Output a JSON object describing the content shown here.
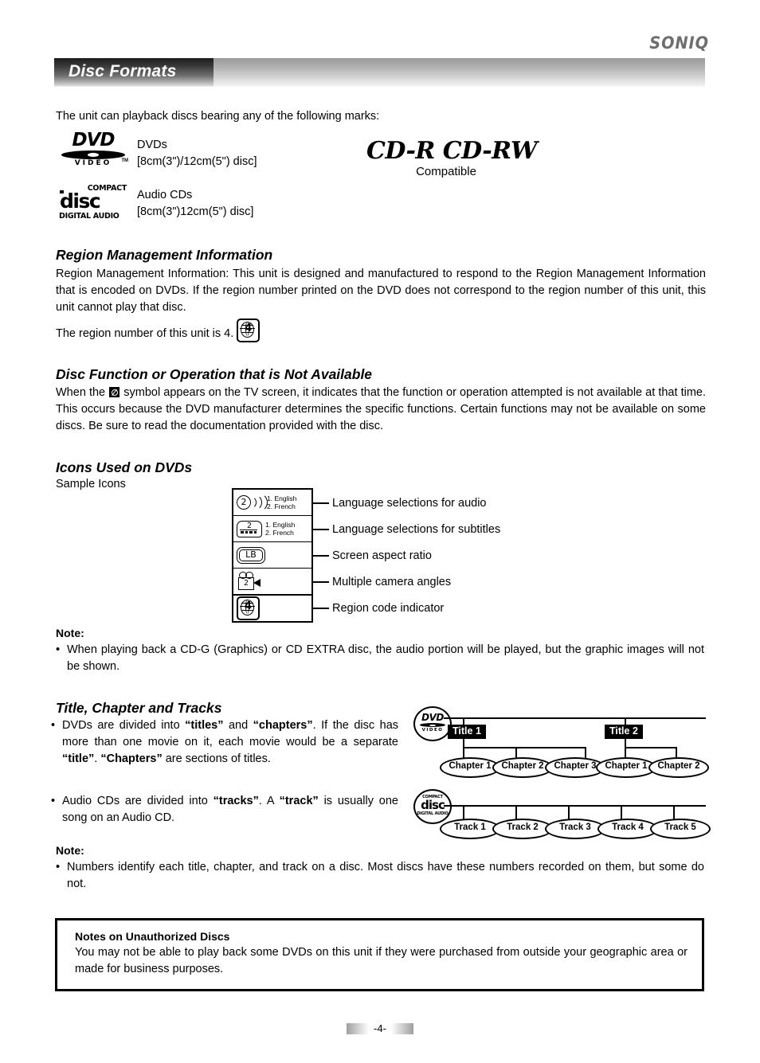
{
  "brand": "SONIQ",
  "header": {
    "title": "Disc Formats"
  },
  "intro": "The unit can playback discs bearing any of the following marks:",
  "disc_marks": {
    "dvd": {
      "logo_word": "DVD",
      "logo_sub": "VIDEO",
      "logo_tm": "TM",
      "label": "DVDs",
      "spec": "[8cm(3\")/12cm(5\") disc]"
    },
    "cd": {
      "logo_top": "COMPACT",
      "logo_mid": "disc",
      "logo_bottom": "DIGITAL AUDIO",
      "label": "Audio CDs",
      "spec": "[8cm(3\")12cm(5\") disc]"
    },
    "cdr": {
      "title": "CD-R  CD-RW",
      "subtitle": "Compatible"
    }
  },
  "region_section": {
    "heading": "Region Management Information",
    "body": "Region Management Information: This unit is designed and manufactured to respond to the Region Management Information that is encoded on DVDs. If the region number printed on the DVD does not correspond to the region number of this unit, this unit cannot play that disc.",
    "region_line": "The region number of this unit is 4.",
    "region_number": "4"
  },
  "not_available_section": {
    "heading": "Disc Function or Operation that is Not Available",
    "body_before": "When the",
    "body_after": "symbol appears on the TV screen, it indicates that the function or operation attempted is not available at that time. This occurs because the DVD manufacturer determines the specific functions. Certain functions may not be available on some discs. Be sure to read the documentation provided with the disc."
  },
  "icons_section": {
    "heading": "Icons Used on DVDs",
    "subheading": "Sample Icons",
    "rows": [
      {
        "icon": "audio-channels-icon",
        "value": "2",
        "lang1": "1. English",
        "lang2": "2. French",
        "label": "Language selections for audio"
      },
      {
        "icon": "subtitle-icon",
        "value": "2",
        "lang1": "1. English",
        "lang2": "2. French",
        "label": "Language selections for subtitles"
      },
      {
        "icon": "letterbox-icon",
        "value": "LB",
        "lang1": "",
        "lang2": "",
        "label": "Screen aspect ratio"
      },
      {
        "icon": "camera-angles-icon",
        "value": "2",
        "lang1": "",
        "lang2": "",
        "label": "Multiple camera angles"
      },
      {
        "icon": "region-code-icon",
        "value": "4",
        "lang1": "",
        "lang2": "",
        "label": "Region code indicator"
      }
    ]
  },
  "note1": {
    "label": "Note:",
    "bullet": "•",
    "text": "When playing back a CD-G (Graphics) or CD EXTRA disc, the audio portion will be  played, but the graphic images will not be shown."
  },
  "title_chapter_section": {
    "heading": "Title, Chapter and Tracks",
    "bullet": "•",
    "b1_p1": "DVDs are divided into ",
    "b1_b1": "“titles”",
    "b1_p2": " and ",
    "b1_b2": "“chapters”",
    "b1_p3": ". If the disc has more than one movie on it, each movie would be a separate ",
    "b1_b3": "“title”",
    "b1_p4": ". ",
    "b1_b4": "“Chapters”",
    "b1_p5": " are sections of titles.",
    "b2_p1": "Audio CDs are divided into ",
    "b2_b1": "“tracks”",
    "b2_p2": ". A ",
    "b2_b2": "“track”",
    "b2_p3": " is usually one song on an Audio CD."
  },
  "diagram": {
    "dvd_row": {
      "disc_icon": "dvd-video-disc-icon",
      "titles": [
        {
          "label": "Title 1",
          "chapters": [
            "Chapter 1",
            "Chapter 2",
            "Chapter 3"
          ]
        },
        {
          "label": "Title 2",
          "chapters": [
            "Chapter 1",
            "Chapter 2"
          ]
        }
      ]
    },
    "cd_row": {
      "disc_icon": "compact-disc-icon",
      "tracks": [
        "Track 1",
        "Track 2",
        "Track 3",
        "Track 4",
        "Track 5"
      ]
    }
  },
  "note2": {
    "label": "Note:",
    "bullet": "•",
    "text": "Numbers identify each title, chapter, and track on a disc. Most discs have these numbers recorded on them, but some do not."
  },
  "unauthorized": {
    "title": "Notes on Unauthorized Discs",
    "body": "You may not be able to play back some DVDs on this unit if they were purchased from outside your geographic area or made for business purposes."
  },
  "footer": {
    "page": "-4-"
  },
  "colors": {
    "ink": "#000000",
    "brand_grey": "#6e6e6e",
    "page_bg": "#ffffff"
  }
}
